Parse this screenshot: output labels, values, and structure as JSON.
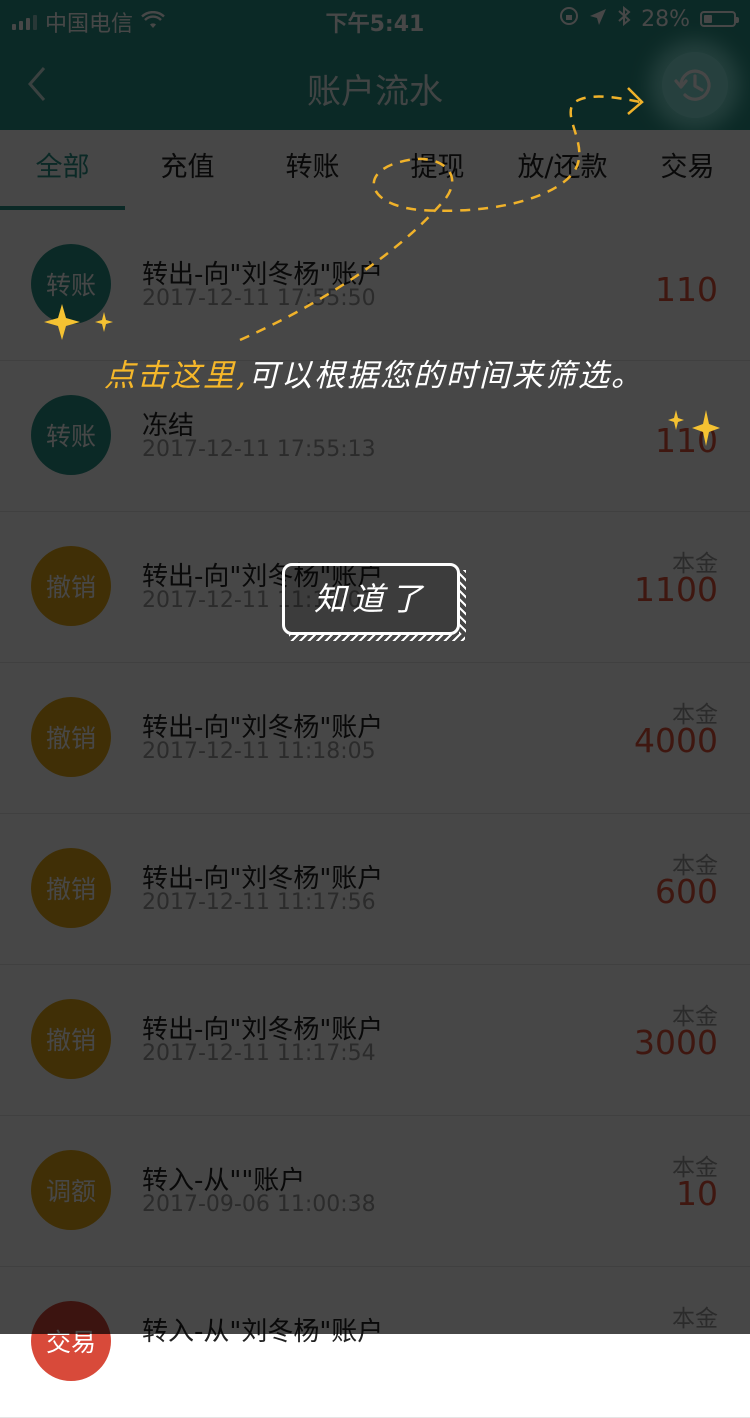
{
  "status_bar": {
    "carrier": "中国电信",
    "time": "下午5:41",
    "battery": "28%"
  },
  "nav": {
    "title": "账户流水",
    "back_icon": "chevron-left-icon",
    "history_icon": "history-clock-icon"
  },
  "tabs": [
    {
      "label": "全部",
      "active": true
    },
    {
      "label": "充值",
      "active": false
    },
    {
      "label": "转账",
      "active": false
    },
    {
      "label": "提现",
      "active": false
    },
    {
      "label": "放/还款",
      "active": false
    },
    {
      "label": "交易",
      "active": false
    }
  ],
  "records": [
    {
      "avatar": "转账",
      "title": "转出-向\"刘冬杨\"账户",
      "time": "2017-12-11 17:55:50",
      "sub": "",
      "amount": "110"
    },
    {
      "avatar": "转账",
      "title": "冻结",
      "time": "2017-12-11 17:55:13",
      "sub": "",
      "amount": "110"
    },
    {
      "avatar": "撤销",
      "title": "转出-向\"刘冬杨\"账户",
      "time": "2017-12-11 11:18:07",
      "sub": "本金",
      "amount": "1100"
    },
    {
      "avatar": "撤销",
      "title": "转出-向\"刘冬杨\"账户",
      "time": "2017-12-11 11:18:05",
      "sub": "本金",
      "amount": "4000"
    },
    {
      "avatar": "撤销",
      "title": "转出-向\"刘冬杨\"账户",
      "time": "2017-12-11 11:17:56",
      "sub": "本金",
      "amount": "600"
    },
    {
      "avatar": "撤销",
      "title": "转出-向\"刘冬杨\"账户",
      "time": "2017-12-11 11:17:54",
      "sub": "本金",
      "amount": "3000"
    },
    {
      "avatar": "调额",
      "title": "转入-从\"\"账户",
      "time": "2017-09-06 11:00:38",
      "sub": "本金",
      "amount": "10"
    },
    {
      "avatar": "交易",
      "title": "转入-从\"刘冬杨\"账户",
      "time": "",
      "sub": "本金",
      "amount": ""
    }
  ],
  "guide": {
    "tip_highlight": "点击这里,",
    "tip_rest": "可以根据您的时间来筛选。",
    "confirm_label": "知道了"
  },
  "colors": {
    "brand_teal": "#2a9488",
    "gold": "#e6a817",
    "red": "#d84a3a",
    "amount": "#e0523a",
    "tip_highlight": "#f5b72a"
  }
}
